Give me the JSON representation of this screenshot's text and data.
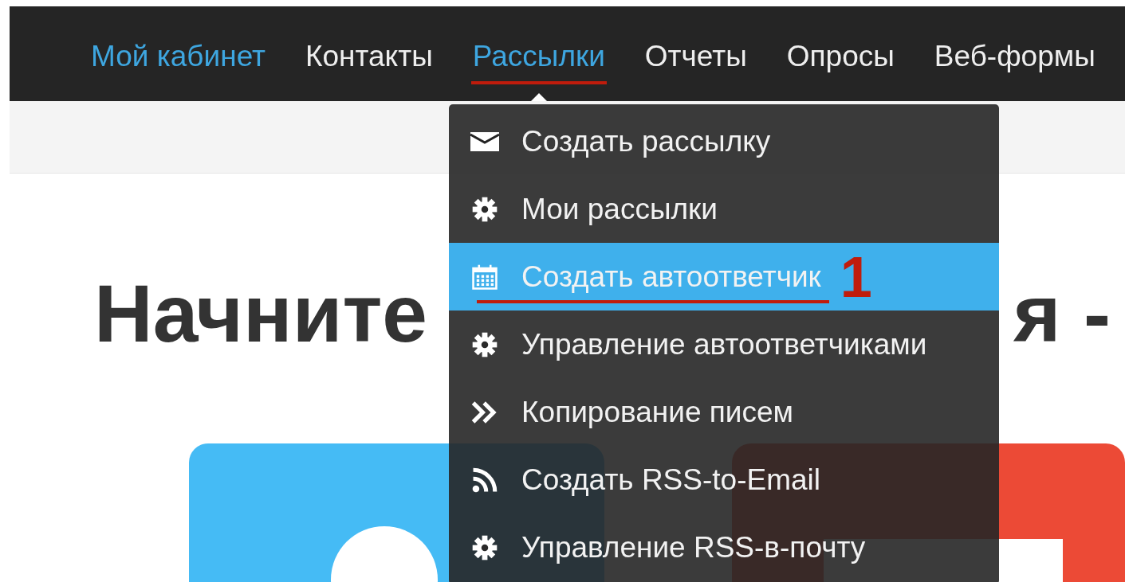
{
  "nav": {
    "items": [
      {
        "label": "Мой кабинет",
        "selected": true,
        "annotated": false,
        "dropdown_open": false
      },
      {
        "label": "Контакты",
        "selected": false,
        "annotated": false,
        "dropdown_open": false
      },
      {
        "label": "Рассылки",
        "selected": true,
        "annotated": true,
        "dropdown_open": true
      },
      {
        "label": "Отчеты",
        "selected": false,
        "annotated": false,
        "dropdown_open": false
      },
      {
        "label": "Опросы",
        "selected": false,
        "annotated": false,
        "dropdown_open": false
      },
      {
        "label": "Веб-формы",
        "selected": false,
        "annotated": false,
        "dropdown_open": false
      }
    ]
  },
  "dropdown": {
    "items": [
      {
        "kind": "envelope",
        "label": "Создать рассылку",
        "selected": false
      },
      {
        "kind": "gear",
        "label": "Мои рассылки",
        "selected": false
      },
      {
        "kind": "calendar",
        "label": "Создать автоответчик",
        "selected": true,
        "annotation": "1"
      },
      {
        "kind": "gear",
        "label": "Управление автоответчиками",
        "selected": false
      },
      {
        "kind": "chevrons",
        "label": "Копирование писем",
        "selected": false
      },
      {
        "kind": "rss",
        "label": "Создать RSS-to-Email",
        "selected": false
      },
      {
        "kind": "gear",
        "label": "Управление RSS-в-почту",
        "selected": false
      }
    ]
  },
  "heading": {
    "visible_parts": [
      "Начните",
      "я -"
    ]
  }
}
